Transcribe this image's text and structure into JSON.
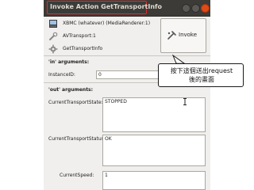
{
  "window": {
    "title": "Invoke Action GetTransportInfo",
    "accent_highlight": "#e02b2b"
  },
  "header": {
    "device": "XBMC (whatever) (MediaRenderer:1)",
    "service": "AVTransport:1",
    "action": "GetTransportInfo",
    "invoke_label": "Invoke"
  },
  "in_arguments": {
    "section_label": "'in' arguments:",
    "fields": [
      {
        "label": "InstanceID:",
        "value": "0"
      }
    ]
  },
  "out_arguments": {
    "section_label": "'out' arguments:",
    "fields": [
      {
        "label": "CurrentTransportState:",
        "value": "STOPPED"
      },
      {
        "label": "CurrentTransportStatus:",
        "value": "OK"
      },
      {
        "label": "CurrentSpeed:",
        "value": "1"
      }
    ]
  },
  "annotation": {
    "line1": "按下這個送出request",
    "line2": "後的畫面"
  }
}
